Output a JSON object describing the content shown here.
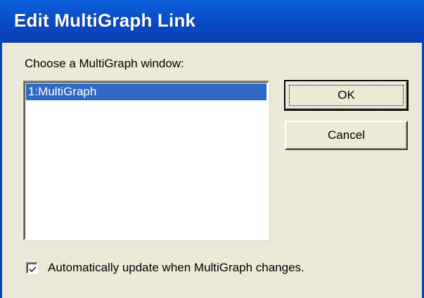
{
  "window": {
    "title": "Edit MultiGraph Link"
  },
  "prompt_label": "Choose a MultiGraph window:",
  "listbox": {
    "items": [
      {
        "label": "1:MultiGraph",
        "selected": true
      }
    ]
  },
  "buttons": {
    "ok_label": "OK",
    "cancel_label": "Cancel"
  },
  "checkbox": {
    "label": "Automatically update when MultiGraph changes.",
    "checked": true
  },
  "colors": {
    "titlebar": "#0a48c2",
    "selection": "#316ac5",
    "dialog_bg": "#ece9d8"
  }
}
